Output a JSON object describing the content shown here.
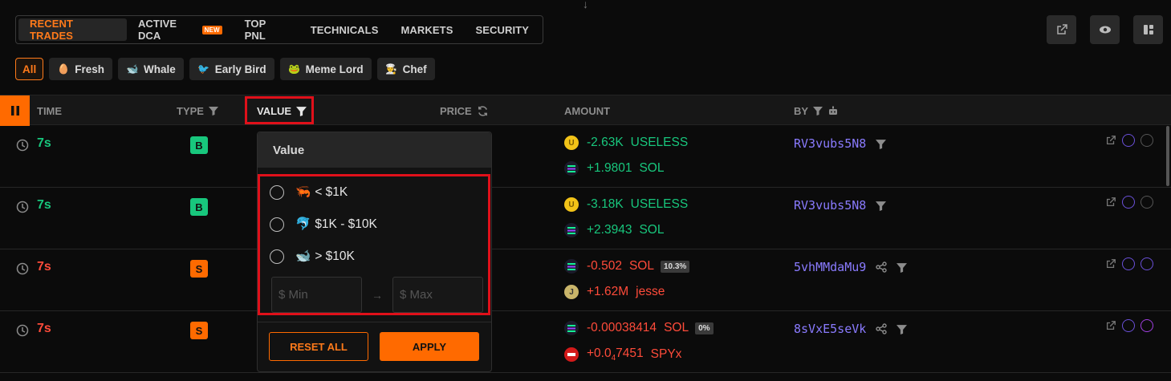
{
  "tabs": [
    {
      "label": "RECENT TRADES",
      "active": true
    },
    {
      "label": "ACTIVE DCA",
      "badge": "NEW"
    },
    {
      "label": "TOP PNL"
    },
    {
      "label": "TECHNICALS"
    },
    {
      "label": "MARKETS"
    },
    {
      "label": "SECURITY"
    }
  ],
  "toolbar_icons": [
    "external-link-icon",
    "eye-icon",
    "layout-icon"
  ],
  "chips": [
    {
      "label": "All",
      "active": true
    },
    {
      "label": "Fresh",
      "icon": "egg-icon"
    },
    {
      "label": "Whale",
      "icon": "whale-icon"
    },
    {
      "label": "Early Bird",
      "icon": "bird-icon"
    },
    {
      "label": "Meme Lord",
      "icon": "frog-icon"
    },
    {
      "label": "Chef",
      "icon": "chef-hat-icon"
    }
  ],
  "columns": {
    "time": "TIME",
    "type": "TYPE",
    "value": "VALUE",
    "price": "PRICE",
    "amount": "AMOUNT",
    "by": "BY"
  },
  "rows": [
    {
      "time": "7s",
      "type": "B",
      "side": "buy",
      "amount1": "-2.63K",
      "token1": "USELESS",
      "amount2": "+1.9801",
      "token2": "SOL",
      "by": "RV3vubs5N8"
    },
    {
      "time": "7s",
      "type": "B",
      "side": "buy",
      "amount1": "-3.18K",
      "token1": "USELESS",
      "amount2": "+2.3943",
      "token2": "SOL",
      "by": "RV3vubs5N8"
    },
    {
      "time": "7s",
      "type": "S",
      "side": "sell",
      "amount1": "-0.502",
      "token1": "SOL",
      "pct": "10.3%",
      "amount2": "+1.62M",
      "token2": "jesse",
      "by": "5vhMMdaMu9"
    },
    {
      "time": "7s",
      "type": "S",
      "side": "sell",
      "amount1": "-0.00038414",
      "token1": "SOL",
      "pct": "0%",
      "amount2": "+0.0",
      "amount2_sub": "4",
      "amount2_tail": "7451",
      "token2": "SPYx",
      "by": "8sVxE5seVk"
    }
  ],
  "value_filter": {
    "title": "Value",
    "options": [
      {
        "label": "< $1K",
        "icon": "shrimp-icon"
      },
      {
        "label": "$1K - $10K",
        "icon": "dolphin-icon"
      },
      {
        "label": "> $10K",
        "icon": "whale-icon"
      }
    ],
    "min_placeholder": "$ Min",
    "max_placeholder": "$ Max",
    "reset_label": "RESET ALL",
    "apply_label": "APPLY"
  },
  "colors": {
    "accent": "#ff6a00",
    "buy": "#18c77d",
    "sell": "#ff4b3a",
    "wallet": "#8a7bff"
  }
}
